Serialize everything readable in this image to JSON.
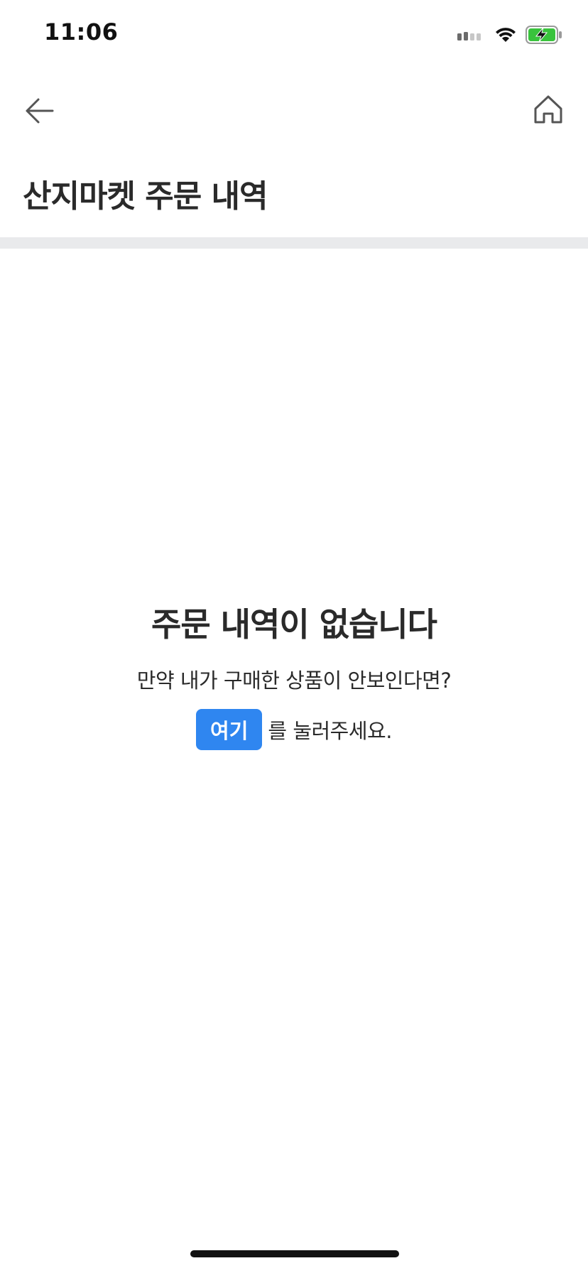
{
  "status_bar": {
    "time": "11:06",
    "icons": [
      "signal-icon",
      "wifi-icon",
      "battery-charging-icon"
    ],
    "battery_color": "#39c33c"
  },
  "nav": {
    "back_icon": "arrow-left-icon",
    "home_icon": "home-icon"
  },
  "page": {
    "title": "산지마켓 주문 내역"
  },
  "empty_state": {
    "title": "주문 내역이 없습니다",
    "description": "만약 내가 구매한 상품이 안보인다면?",
    "button_label": "여기",
    "action_suffix": "를 눌러주세요."
  },
  "colors": {
    "accent": "#2f86f0",
    "divider": "#e9eaec",
    "text": "#2a2a2a"
  }
}
